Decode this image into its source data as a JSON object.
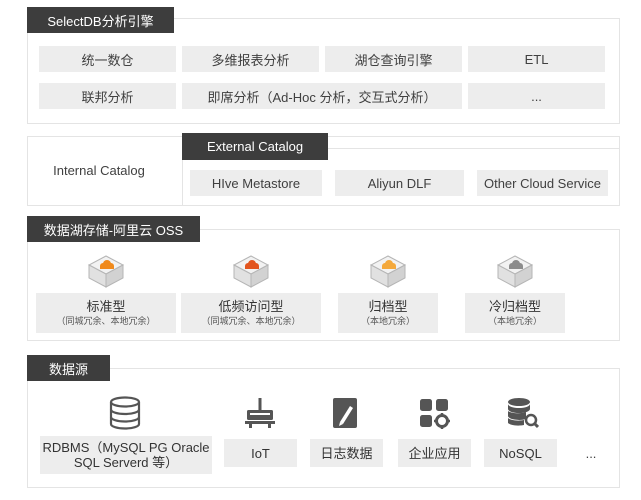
{
  "engine": {
    "title": "SelectDB分析引擎",
    "items": [
      "统一数仓",
      "多维报表分析",
      "湖仓查询引擎",
      "ETL",
      "联邦分析",
      "即席分析（Ad-Hoc 分析，交互式分析）",
      "..."
    ]
  },
  "catalog": {
    "internal": "Internal Catalog",
    "external_title": "External Catalog",
    "external_items": [
      "HIve Metastore",
      "Aliyun DLF",
      "Other Cloud Service"
    ]
  },
  "storage": {
    "title": "数据湖存储-阿里云 OSS",
    "tiers": [
      {
        "name": "标准型",
        "note": "（同城冗余、本地冗余）"
      },
      {
        "name": "低频访问型",
        "note": "（同城冗余、本地冗余）"
      },
      {
        "name": "归档型",
        "note": "（本地冗余）"
      },
      {
        "name": "冷归档型",
        "note": "（本地冗余）"
      }
    ]
  },
  "sources": {
    "title": "数据源",
    "rdbms_line1": "RDBMS（MySQL PG Oracle",
    "rdbms_line2": "SQL Serverd 等）",
    "items": [
      "IoT",
      "日志数据",
      "企业应用",
      "NoSQL"
    ],
    "more": "..."
  },
  "colors": {
    "header_bg": "#3d3d3d",
    "cell_bg": "#ededed",
    "cloud_orange": "#f08a1c",
    "icon_gray": "#555555"
  }
}
